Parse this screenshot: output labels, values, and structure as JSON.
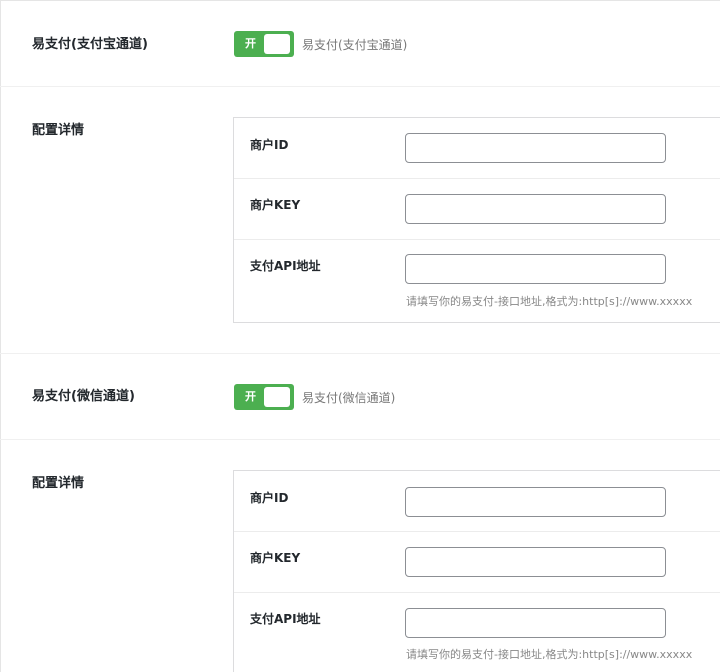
{
  "sections": [
    {
      "toggle": {
        "label": "易支付(支付宝通道)",
        "state_text": "开",
        "description": "易支付(支付宝通道)"
      },
      "config": {
        "label": "配置详情",
        "fields": [
          {
            "label": "商户ID",
            "value": ""
          },
          {
            "label": "商户KEY",
            "value": ""
          },
          {
            "label": "支付API地址",
            "value": "",
            "hint": "请填写你的易支付-接口地址,格式为:http[s]://www.xxxxx"
          }
        ]
      }
    },
    {
      "toggle": {
        "label": "易支付(微信通道)",
        "state_text": "开",
        "description": "易支付(微信通道)"
      },
      "config": {
        "label": "配置详情",
        "fields": [
          {
            "label": "商户ID",
            "value": ""
          },
          {
            "label": "商户KEY",
            "value": ""
          },
          {
            "label": "支付API地址",
            "value": "",
            "hint": "请填写你的易支付-接口地址,格式为:http[s]://www.xxxxx"
          }
        ]
      }
    }
  ]
}
